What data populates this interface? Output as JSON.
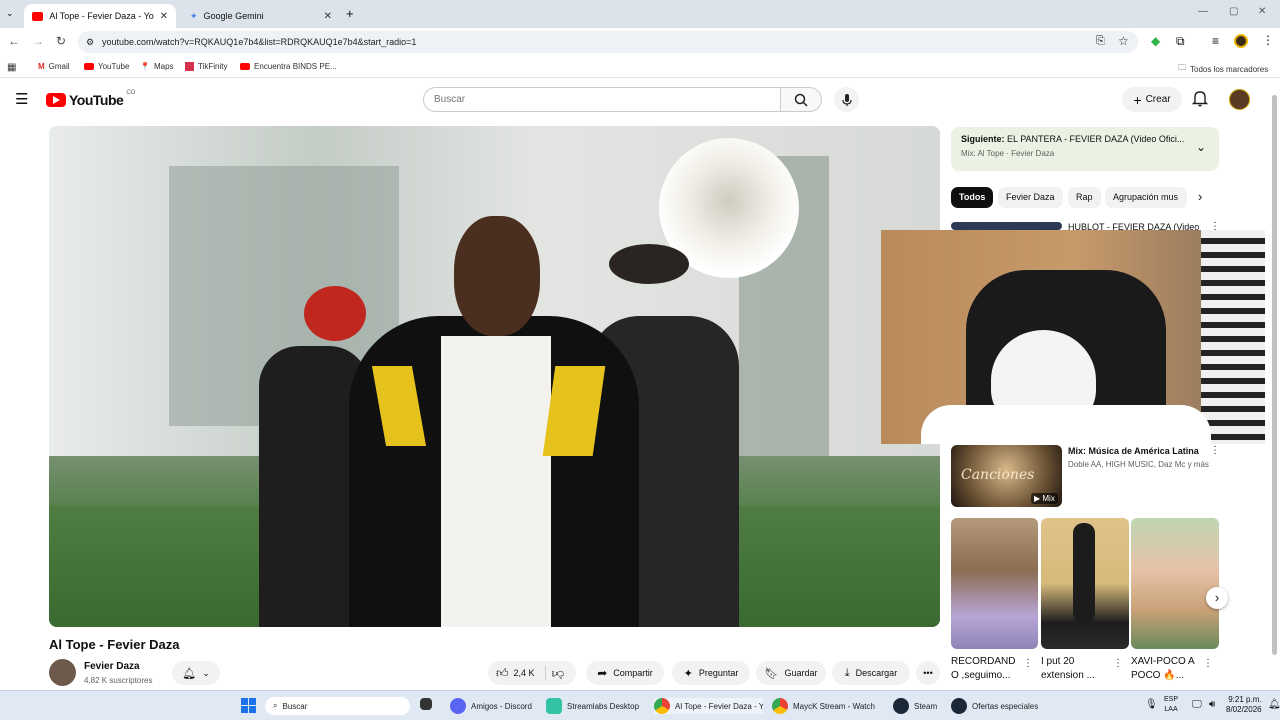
{
  "browser": {
    "tabs": [
      {
        "title": "Al Tope - Fevier Daza - YouTube"
      },
      {
        "title": "Google Gemini"
      }
    ],
    "url": "youtube.com/watch?v=RQKAUQ1e7b4&list=RDRQKAUQ1e7b4&start_radio=1",
    "bookmarks": [
      "Gmail",
      "YouTube",
      "Maps",
      "TikFinity",
      "Encuentra BINDS PE..."
    ],
    "all_bookmarks_label": "Todos los marcadores"
  },
  "youtube": {
    "logo_text": "YouTube",
    "country_code": "CO",
    "search_placeholder": "Buscar",
    "create_label": "Crear"
  },
  "video": {
    "title": "Al Tope - Fevier Daza",
    "channel": "Fevier Daza",
    "subscribers": "4,82 K suscriptores",
    "likes": "2,4 K",
    "share_label": "Compartir",
    "ask_label": "Preguntar",
    "save_label": "Guardar",
    "download_label": "Descargar"
  },
  "sidebar": {
    "next_label": "Siguiente:",
    "next_title": "EL PANTERA - FEVIER DAZA (Video Ofici...",
    "mix_label": "Mix: Al Tope · Fevier Daza",
    "chips": [
      "Todos",
      "Fevier Daza",
      "Rap",
      "Agrupación mus"
    ],
    "first_item_title": "HUBLOT - FEVIER DAZA (Video",
    "mix_title": "Mix: Música de América Latina",
    "mix_artists": "Doble AA, HIGH MUSIC, Daz Mc y más",
    "mix_badge": "Mix",
    "mix_thumb_text": "Canciones",
    "shorts": [
      {
        "title": "RECORDAND O ,seguimo..."
      },
      {
        "title": "I put 20 extension ..."
      },
      {
        "title": "XAVI-POCO A POCO 🔥..."
      }
    ]
  },
  "taskbar": {
    "search_label": "Buscar",
    "apps": [
      "Amigos - Discord",
      "Streamlabs Desktop",
      "Al Tope - Fevier Daza - Y",
      "MaycK Stream - Watch",
      "Steam",
      "Ofertas especiales"
    ],
    "lang": "ESP",
    "lang_sub": "LAA",
    "time": "9:21 p.m.",
    "date": "8/02/2026"
  },
  "colors": {
    "youtube_red": "#ff0000",
    "chip_active": "#0f0f0f",
    "next_card_bg": "#ecf2e3"
  }
}
